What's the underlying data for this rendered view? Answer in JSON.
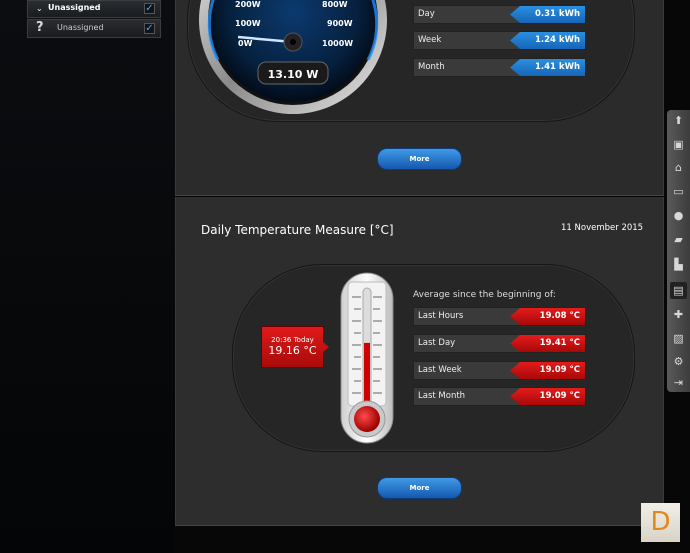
{
  "sidebar": {
    "items": [
      {
        "label": "Unassigned",
        "icon": "chevron-down",
        "checked": true
      },
      {
        "label": "Unassigned",
        "icon": "question",
        "checked": true
      }
    ]
  },
  "power": {
    "gauge_ticks": [
      "200W",
      "800W",
      "100W",
      "900W",
      "0W",
      "1000W"
    ],
    "current": "13.10 W",
    "rows": [
      {
        "label": "Day",
        "value": "0.31 kWh"
      },
      {
        "label": "Week",
        "value": "1.24 kWh"
      },
      {
        "label": "Month",
        "value": "1.41 kWh"
      }
    ],
    "more_label": "More"
  },
  "temperature": {
    "title": "Daily Temperature Measure [°C]",
    "date": "11 November 2015",
    "current_time": "20:36 Today",
    "current_value": "19.16 °C",
    "average_label": "Average since the beginning of:",
    "rows": [
      {
        "label": "Last Hours",
        "value": "19.08 °C"
      },
      {
        "label": "Last Day",
        "value": "19.41 °C"
      },
      {
        "label": "Last Week",
        "value": "19.09 °C"
      },
      {
        "label": "Last Month",
        "value": "19.09 °C"
      }
    ],
    "more_label": "More",
    "thermometer_level": 0.55
  },
  "toolbar": {
    "icons": [
      "arrow-up-icon",
      "save-icon",
      "home-icon",
      "monitor-icon",
      "pin-icon",
      "folder-icon",
      "chart-icon",
      "gift-icon",
      "puzzle-icon",
      "clipboard-icon",
      "settings-icon",
      "exit-icon"
    ]
  },
  "logo": {
    "text": "D"
  },
  "colors": {
    "accent_blue": "#1f7fd6",
    "accent_red": "#d01010"
  }
}
